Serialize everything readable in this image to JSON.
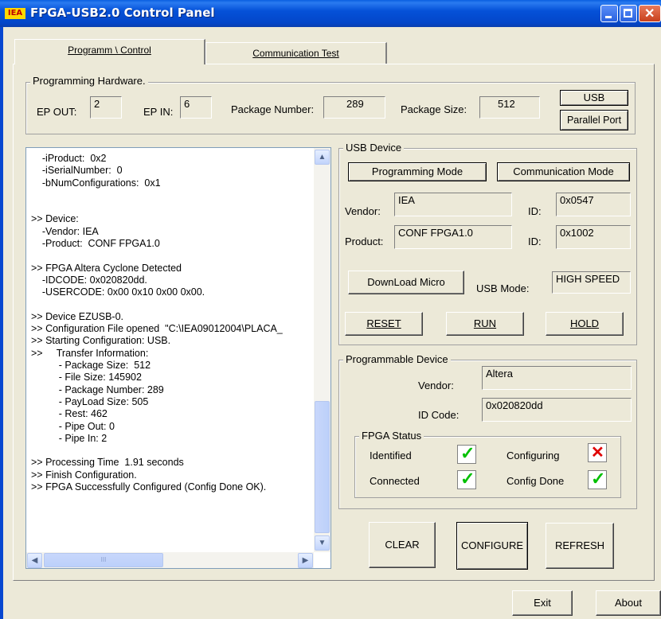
{
  "window": {
    "title": "FPGA-USB2.0 Control Panel",
    "icon_text": "IEA"
  },
  "tabs": [
    {
      "label": "Programm \\ Control"
    },
    {
      "label": "Communication Test"
    }
  ],
  "programming_hardware": {
    "title": "Programming Hardware.",
    "ep_out_label": "EP OUT:",
    "ep_out": "2",
    "ep_in_label": "EP IN:",
    "ep_in": "6",
    "package_number_label": "Package Number:",
    "package_number": "289",
    "package_size_label": "Package Size:",
    "package_size": "512",
    "usb_button": "USB",
    "parallel_button": "Parallel Port"
  },
  "log": {
    "lines": [
      "    -iProduct:  0x2",
      "    -iSerialNumber:  0",
      "    -bNumConfigurations:  0x1",
      "",
      "",
      ">> Device:",
      "    -Vendor: IEA",
      "    -Product:  CONF FPGA1.0",
      "",
      ">> FPGA Altera Cyclone Detected",
      "    -IDCODE: 0x020820dd.",
      "    -USERCODE: 0x00 0x10 0x00 0x00.",
      "",
      ">> Device EZUSB-0.",
      ">> Configuration File opened  \"C:\\IEA09012004\\PLACA_",
      ">> Starting Configuration: USB.",
      ">>     Transfer Information:",
      "          - Package Size:  512",
      "          - File Size: 145902",
      "          - Package Number: 289",
      "          - PayLoad Size: 505",
      "          - Rest: 462",
      "          - Pipe Out: 0",
      "          - Pipe In: 2",
      "",
      ">> Processing Time  1.91 seconds",
      ">> Finish Configuration.",
      ">> FPGA Successfully Configured (Config Done OK)."
    ]
  },
  "usb_device": {
    "title": "USB Device",
    "programming_mode_button": "Programming Mode",
    "communication_mode_button": "Communication Mode",
    "vendor_label": "Vendor:",
    "vendor": "IEA",
    "vendor_id_label": "ID:",
    "vendor_id": "0x0547",
    "product_label": "Product:",
    "product": "CONF FPGA1.0",
    "product_id_label": "ID:",
    "product_id": "0x1002",
    "download_micro_button": "DownLoad Micro",
    "usb_mode_label": "USB Mode:",
    "usb_mode": "HIGH SPEED",
    "reset_button": "RESET",
    "run_button": "RUN",
    "hold_button": "HOLD"
  },
  "programmable_device": {
    "title": "Programmable Device",
    "vendor_label": "Vendor:",
    "vendor": "Altera",
    "id_code_label": "ID Code:",
    "id_code": "0x020820dd",
    "fpga_status": {
      "title": "FPGA Status",
      "identified_label": "Identified",
      "identified": true,
      "configuring_label": "Configuring",
      "configuring": false,
      "connected_label": "Connected",
      "connected": true,
      "config_done_label": "Config Done",
      "config_done": true
    }
  },
  "actions": {
    "clear": "CLEAR",
    "configure": "CONFIGURE",
    "refresh": "REFRESH"
  },
  "footer": {
    "exit": "Exit",
    "about": "About"
  },
  "colors": {
    "titlebar": "#0551d8",
    "window_bg": "#ece9d8",
    "ok_check": "#00c000",
    "fail_cross": "#e00000"
  }
}
